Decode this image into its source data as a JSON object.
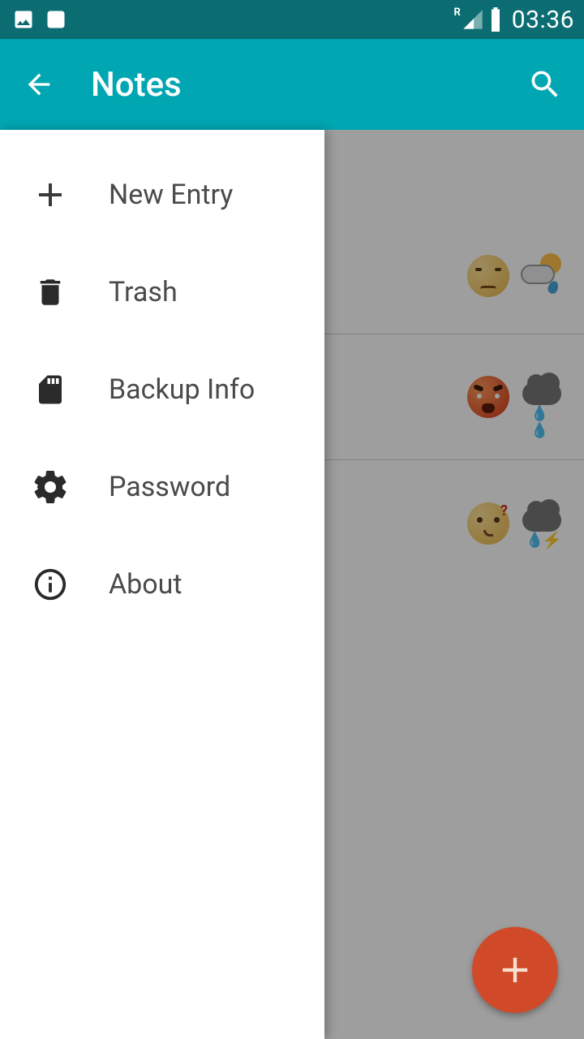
{
  "status": {
    "time": "03:36",
    "roaming_label": "R"
  },
  "app_bar": {
    "title": "Notes"
  },
  "drawer": {
    "items": [
      {
        "label": "New Entry",
        "icon": "plus-icon"
      },
      {
        "label": "Trash",
        "icon": "trash-icon"
      },
      {
        "label": "Backup Info",
        "icon": "sdcard-icon"
      },
      {
        "label": "Password",
        "icon": "gear-icon"
      },
      {
        "label": "About",
        "icon": "info-icon"
      }
    ]
  },
  "notes": {
    "rows": [
      {
        "mood": "unamused",
        "weather": "sun-rain"
      },
      {
        "mood": "angry",
        "weather": "rain"
      },
      {
        "mood": "confused",
        "weather": "storm"
      }
    ]
  },
  "colors": {
    "status_bg": "#0b6d72",
    "app_bar_bg": "#00a6b2",
    "fab_bg": "#d04a2a"
  }
}
